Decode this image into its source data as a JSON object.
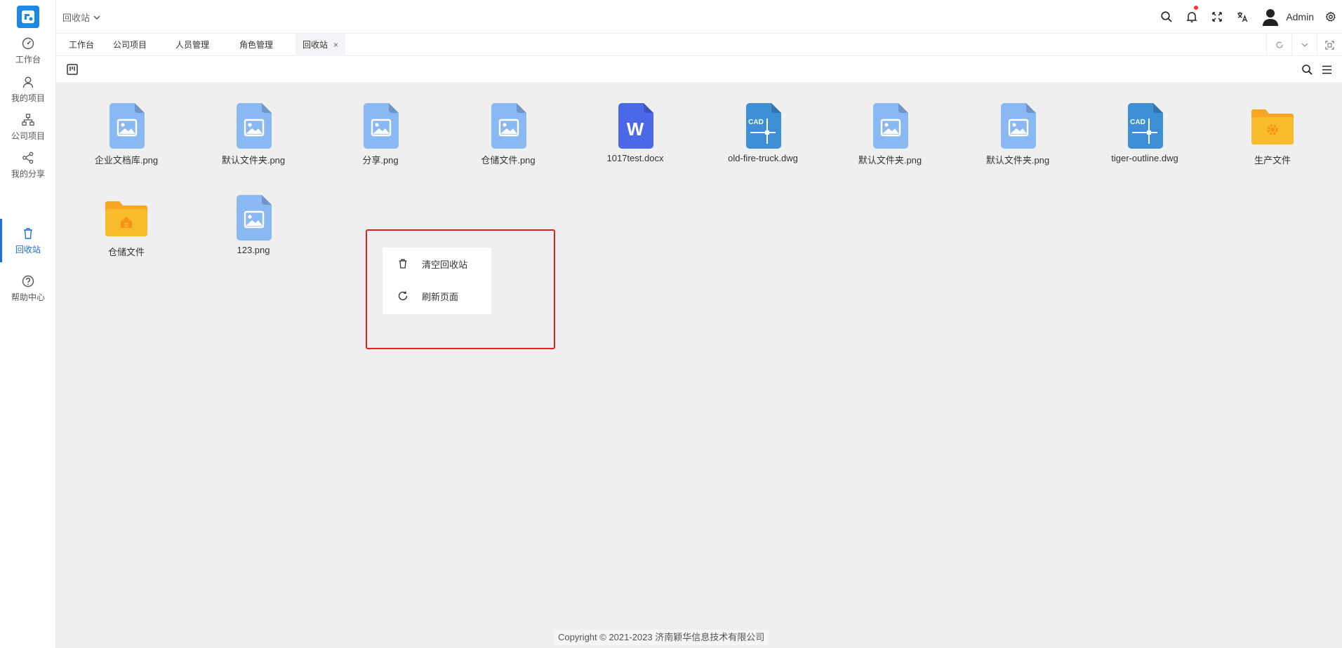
{
  "sidebar": {
    "items": [
      {
        "label": "工作台",
        "icon": "dashboard-icon"
      },
      {
        "label": "我的项目",
        "icon": "user-icon"
      },
      {
        "label": "公司项目",
        "icon": "org-icon"
      },
      {
        "label": "我的分享",
        "icon": "share-icon"
      },
      {
        "label": "回收站",
        "icon": "trash-icon",
        "active": true
      },
      {
        "label": "帮助中心",
        "icon": "help-icon"
      }
    ]
  },
  "header": {
    "breadcrumb": "回收站",
    "user_name": "Admin"
  },
  "tabs": [
    {
      "label": "工作台"
    },
    {
      "label": "公司项目"
    },
    {
      "label": "人员管理"
    },
    {
      "label": "角色管理"
    },
    {
      "label": "回收站",
      "active": true,
      "close": "×"
    }
  ],
  "files": [
    {
      "name": "企业文档库.png",
      "type": "image"
    },
    {
      "name": "默认文件夹.png",
      "type": "image"
    },
    {
      "name": "分享.png",
      "type": "image"
    },
    {
      "name": "仓储文件.png",
      "type": "image"
    },
    {
      "name": "1017test.docx",
      "type": "word"
    },
    {
      "name": "old-fire-truck.dwg",
      "type": "cad"
    },
    {
      "name": "默认文件夹.png",
      "type": "image"
    },
    {
      "name": "默认文件夹.png",
      "type": "image"
    },
    {
      "name": "tiger-outline.dwg",
      "type": "cad"
    },
    {
      "name": "生产文件",
      "type": "folder-gear"
    },
    {
      "name": "仓储文件",
      "type": "folder-home"
    },
    {
      "name": "123.png",
      "type": "image"
    }
  ],
  "icon_text": {
    "word": "W",
    "cad": "CAD"
  },
  "context_menu": {
    "items": [
      {
        "label": "清空回收站",
        "icon": "trash-icon"
      },
      {
        "label": "刷新页面",
        "icon": "refresh-icon"
      }
    ]
  },
  "footer": {
    "copyright": "Copyright © 2021-2023 济南颖华信息技术有限公司"
  },
  "colors": {
    "accent": "#1e6fd9",
    "image_icon": "#8ab8f2",
    "word_icon": "#4a68e8",
    "cad_icon": "#3d8fd6",
    "folder": "#f8bb2c",
    "highlight": "#e02020",
    "notify_dot": "#ff3333"
  }
}
